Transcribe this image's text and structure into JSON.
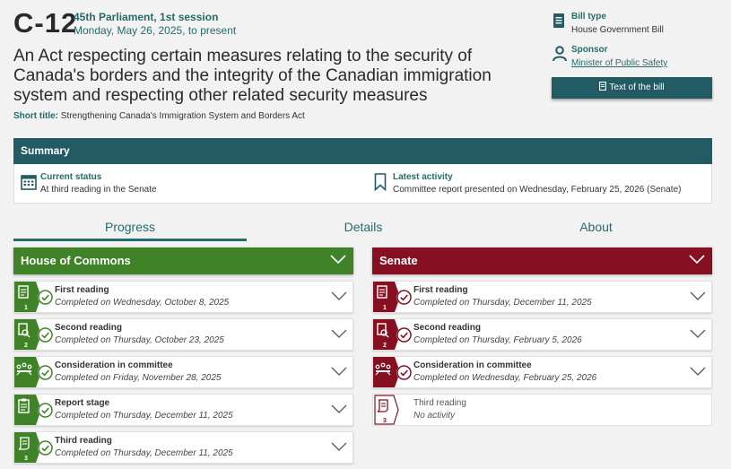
{
  "bill": {
    "number": "C-12",
    "session": "45th Parliament, 1st session",
    "date": "Monday, May 26, 2025, to present",
    "title": "An Act respecting certain measures relating to the security of Canada's borders and the integrity of the Canadian immigration system and respecting other related security measures",
    "short_title_label": "Short title:",
    "short_title": "Strengthening Canada's Immigration System and Borders Act"
  },
  "meta": {
    "bill_type_label": "Bill type",
    "bill_type": "House Government Bill",
    "sponsor_label": "Sponsor",
    "sponsor": "Minister of Public Safety",
    "text_button": "Text of the bill"
  },
  "summary": {
    "heading": "Summary",
    "status_label": "Current status",
    "status": "At third reading in the Senate",
    "activity_label": "Latest activity",
    "activity": "Committee report presented on Wednesday, February 25, 2026 (Senate)"
  },
  "tabs": [
    "Progress",
    "Details",
    "About"
  ],
  "colors": {
    "teal": "#235b64",
    "house_green": "#3f8228",
    "senate_red": "#861022"
  },
  "house": {
    "heading": "House of Commons",
    "stages": [
      {
        "name": "First reading",
        "detail": "Completed on Wednesday, October 8, 2025",
        "num": "1",
        "icon": "document-icon"
      },
      {
        "name": "Second reading",
        "detail": "Completed on Thursday, October 23, 2025",
        "num": "2",
        "icon": "magnifier-document-icon"
      },
      {
        "name": "Consideration in committee",
        "detail": "Completed on Friday, November 28, 2025",
        "num": "",
        "icon": "committee-icon"
      },
      {
        "name": "Report stage",
        "detail": "Completed on Thursday, December 11, 2025",
        "num": "",
        "icon": "clipboard-icon"
      },
      {
        "name": "Third reading",
        "detail": "Completed on Thursday, December 11, 2025",
        "num": "3",
        "icon": "scroll-icon"
      }
    ]
  },
  "senate": {
    "heading": "Senate",
    "stages": [
      {
        "name": "First reading",
        "detail": "Completed on Thursday, December 11, 2025",
        "num": "1",
        "icon": "document-icon"
      },
      {
        "name": "Second reading",
        "detail": "Completed on Thursday, February 5, 2026",
        "num": "2",
        "icon": "magnifier-document-icon"
      },
      {
        "name": "Consideration in committee",
        "detail": "Completed on Wednesday, February 25, 2026",
        "num": "",
        "icon": "committee-icon"
      },
      {
        "name": "Third reading",
        "detail": "No activity",
        "num": "3",
        "icon": "scroll-icon"
      }
    ]
  }
}
